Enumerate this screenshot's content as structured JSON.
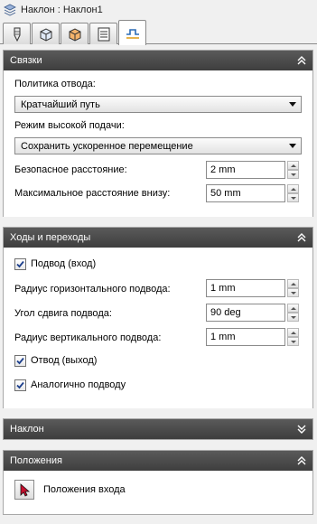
{
  "window": {
    "title": "Наклон : Наклон1",
    "title_icon": "layers-stack-icon"
  },
  "tabs": [
    {
      "icon": "tool-icon",
      "active": false
    },
    {
      "icon": "cube-icon",
      "active": false
    },
    {
      "icon": "stock-box-icon",
      "active": false
    },
    {
      "icon": "document-list-icon",
      "active": false
    },
    {
      "icon": "linking-move-icon",
      "active": true
    }
  ],
  "links": {
    "header": "Связки",
    "retract_policy_label": "Политика отвода:",
    "retract_policy_value": "Кратчайший путь",
    "high_feed_label": "Режим высокой подачи:",
    "high_feed_value": "Сохранить ускоренное перемещение",
    "safe_distance_label": "Безопасное расстояние:",
    "safe_distance_value": "2 mm",
    "max_stay_down_label": "Максимальное расстояние внизу:",
    "max_stay_down_value": "50 mm"
  },
  "leads": {
    "header": "Ходы и переходы",
    "lead_in_label": "Подвод (вход)",
    "lead_in_checked": true,
    "horiz_radius_label": "Радиус горизонтального подвода:",
    "horiz_radius_value": "1 mm",
    "sweep_angle_label": "Угол сдвига подвода:",
    "sweep_angle_value": "90 deg",
    "vert_radius_label": "Радиус вертикального подвода:",
    "vert_radius_value": "1 mm",
    "lead_out_label": "Отвод (выход)",
    "lead_out_checked": true,
    "same_as_lead_in_label": "Аналогично подводу",
    "same_as_lead_in_checked": true
  },
  "ramp": {
    "header": "Наклон"
  },
  "positions": {
    "header": "Положения",
    "entry_positions_label": "Положения входа"
  },
  "colors": {
    "header_bg": "#4a4a4a",
    "check_mark": "#1c3f8c",
    "pick_cursor": "#c8102e"
  }
}
